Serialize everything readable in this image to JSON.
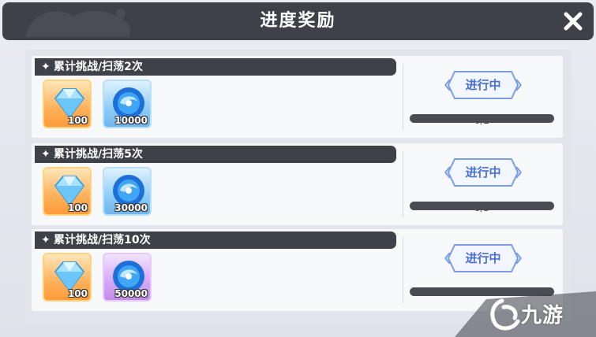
{
  "header": {
    "title": "进度奖励"
  },
  "colors": {
    "accent": "#4a6fd3",
    "header_bg": "#3f4148",
    "progress_track": "#4a4c54"
  },
  "tasks": [
    {
      "title": "累计挑战/扫荡2次",
      "rewards": [
        {
          "icon": "diamond-icon",
          "count": "100",
          "frame": "orange"
        },
        {
          "icon": "blue-orb-icon",
          "count": "10000",
          "frame": "blue"
        }
      ],
      "status": "进行中",
      "progress": "0/2"
    },
    {
      "title": "累计挑战/扫荡5次",
      "rewards": [
        {
          "icon": "diamond-icon",
          "count": "100",
          "frame": "orange"
        },
        {
          "icon": "blue-orb-icon",
          "count": "30000",
          "frame": "blue"
        }
      ],
      "status": "进行中",
      "progress": "0/5"
    },
    {
      "title": "累计挑战/扫荡10次",
      "rewards": [
        {
          "icon": "diamond-icon",
          "count": "100",
          "frame": "orange"
        },
        {
          "icon": "blue-orb-icon",
          "count": "50000",
          "frame": "purple"
        }
      ],
      "status": "进行中",
      "progress": ""
    }
  ],
  "watermark": {
    "text": "九游"
  }
}
